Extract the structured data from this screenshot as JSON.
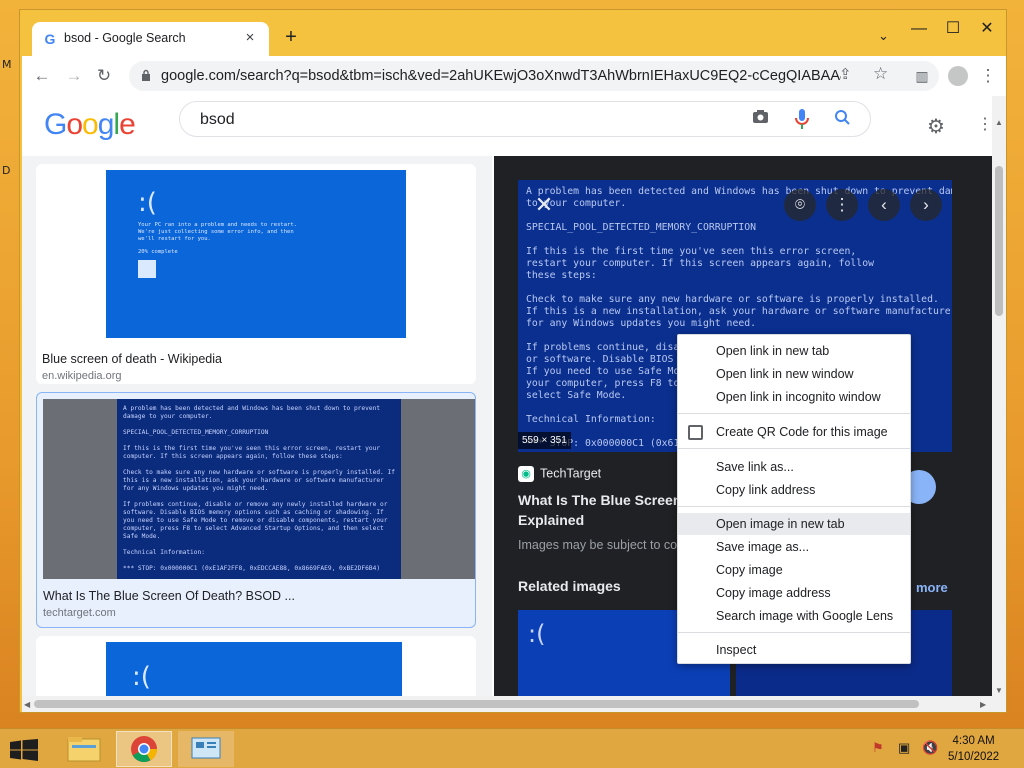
{
  "desktop": {
    "edge_letters": [
      "M",
      "D"
    ]
  },
  "browser": {
    "tab": {
      "title": "bsod - Google Search",
      "favicon": "google-g-icon",
      "close": "×"
    },
    "new_tab": "+",
    "tab_search": "⌄",
    "window_controls": {
      "minimize": "—",
      "maximize": "☐",
      "close": "✕"
    },
    "nav": {
      "back": "←",
      "forward": "→",
      "reload": "↻"
    },
    "url": "google.com/search?q=bsod&tbm=isch&ved=2ahUKEwjO3oXnwdT3AhWbrnIEHaxUC9EQ2-cCegQIABAA&...",
    "more_icon": "⋮"
  },
  "google": {
    "logo_letters": [
      {
        "ch": "G",
        "color": "#4285f4"
      },
      {
        "ch": "o",
        "color": "#ea4335"
      },
      {
        "ch": "o",
        "color": "#fbbc05"
      },
      {
        "ch": "g",
        "color": "#4285f4"
      },
      {
        "ch": "l",
        "color": "#34a853"
      },
      {
        "ch": "e",
        "color": "#ea4335"
      }
    ],
    "query": "bsod"
  },
  "results": [
    {
      "caption": "Blue screen of death - Wikipedia",
      "domain": "en.wikipedia.org",
      "thumb_face": ":(",
      "thumb_text": "Your PC ran into a problem and needs to restart. We're just collecting some error info, and then we'll restart for you.",
      "thumb_progress": "20% complete"
    },
    {
      "caption": "What Is The Blue Screen Of Death? BSOD ...",
      "domain": "techtarget.com",
      "thumb_text": "A problem has been detected and Windows has been shut down to prevent damage to your computer.\n\nSPECIAL_POOL_DETECTED_MEMORY_CORRUPTION\n\nIf this is the first time you've seen this error screen, restart your computer. If this screen appears again, follow these steps:\n\nCheck to make sure any new hardware or software is properly installed. If this is a new installation, ask your hardware or software manufacturer for any Windows updates you might need.\n\nIf problems continue, disable or remove any newly installed hardware or software. Disable BIOS memory options such as caching or shadowing. If you need to use Safe Mode to remove or disable components, restart your computer, press F8 to select Advanced Startup Options, and then select Safe Mode.\n\nTechnical Information:\n\n*** STOP: 0x000000C1 (0xE1AF2FF8, 0xEDCCAE88, 0x8669FAE9, 0xBE2DF6B4)"
    },
    {
      "thumb_face": ":("
    }
  ],
  "preview": {
    "image_text": "A problem has been detected and Windows has been shut down to prevent damage\nto your computer.\n\nSPECIAL_POOL_DETECTED_MEMORY_CORRUPTION\n\nIf this is the first time you've seen this error screen,\nrestart your computer. If this screen appears again, follow\nthese steps:\n\nCheck to make sure any new hardware or software is properly installed.\nIf this is a new installation, ask your hardware or software manufacturer\nfor any Windows updates you might need.\n\nIf problems continue, disable\nor software. Disable BIOS\nIf you need to use Safe Mode\nyour computer, press F8 to\nselect Safe Mode.\n\nTechnical Information:\n\n*** STOP: 0x000000C1 (0x61AF",
    "dimensions": "559 × 351",
    "source": "TechTarget",
    "title": "What Is The Blue Screen Explained",
    "note": "Images may be subject to co",
    "related_heading": "Related images",
    "more": "more",
    "related_faces": [
      ":(",
      ""
    ]
  },
  "context_menu": {
    "groups": [
      [
        "Open link in new tab",
        "Open link in new window",
        "Open link in incognito window"
      ],
      [
        "Create QR Code for this image"
      ],
      [
        "Save link as...",
        "Copy link address"
      ],
      [
        "Open image in new tab",
        "Save image as...",
        "Copy image",
        "Copy image address",
        "Search image with Google Lens"
      ],
      [
        "Inspect"
      ]
    ],
    "highlighted": "Open image in new tab"
  },
  "taskbar": {
    "apps": [
      "file-explorer-icon",
      "chrome-icon",
      "control-panel-icon"
    ],
    "active_app": "chrome-icon",
    "time": "4:30 AM",
    "date": "5/10/2022"
  }
}
